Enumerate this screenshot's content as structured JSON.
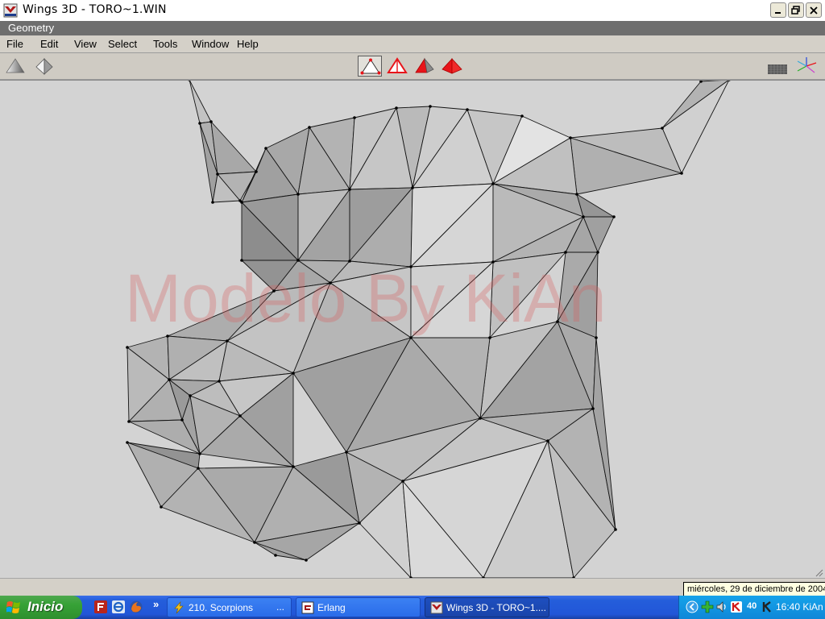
{
  "window": {
    "title": "Wings 3D - TORO~1.WIN",
    "mode_label": "Geometry"
  },
  "menu": [
    "File",
    "Edit",
    "View",
    "Select",
    "Tools",
    "Window",
    "Help"
  ],
  "viewport": {
    "watermark": "Modelo By KiAn"
  },
  "statusbar": {
    "date_tooltip": "miércoles, 29 de diciembre de 2004"
  },
  "taskbar": {
    "start_label": "Inicio",
    "chevron": "»",
    "tasks": [
      {
        "label": "210. Scorpions",
        "extra": "...",
        "active": false
      },
      {
        "label": "Erlang",
        "extra": "",
        "active": false
      },
      {
        "label": "Wings 3D - TORO~1....",
        "extra": "",
        "active": true
      }
    ],
    "tray_badge": "40",
    "clock": "16:40 KiAn"
  },
  "colors": {
    "select_red": "#e8141a",
    "viewport_bg": "#d3d3d3",
    "watermark": "#d66060",
    "taskbar_blue": "#245edb",
    "start_green": "#36a136"
  }
}
